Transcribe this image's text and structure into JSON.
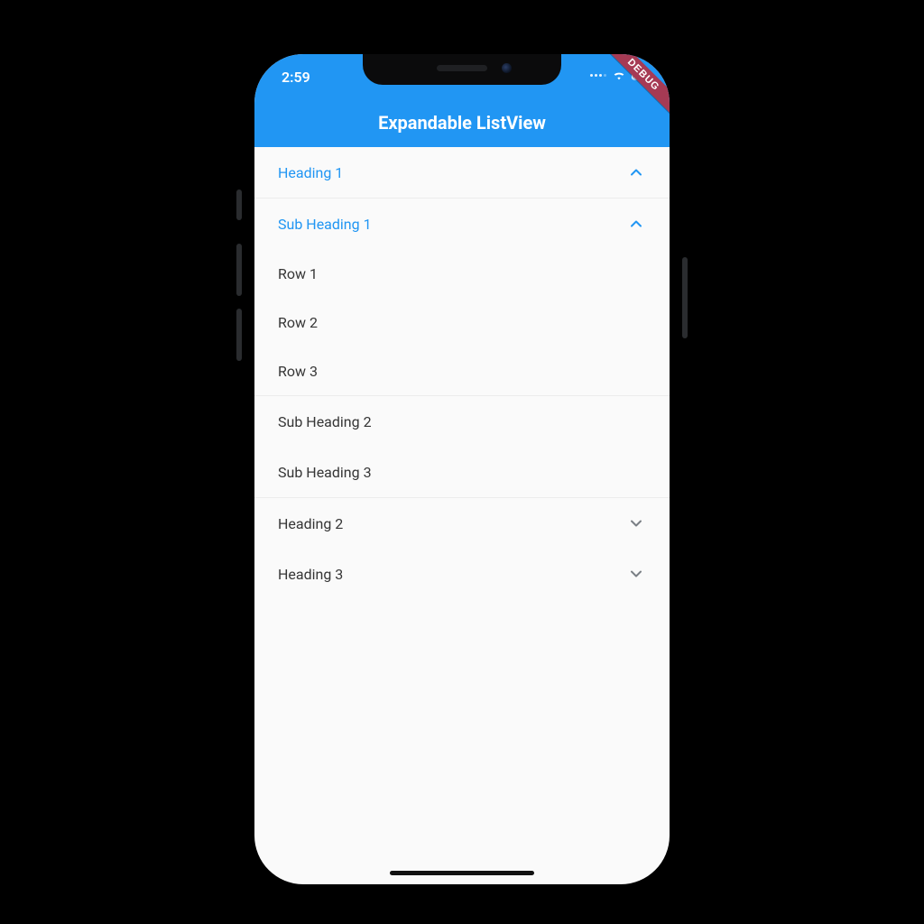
{
  "statusbar": {
    "time": "2:59"
  },
  "debug_banner": "DEBUG",
  "appbar": {
    "title": "Expandable ListView"
  },
  "colors": {
    "primary": "#2196f3"
  },
  "list": {
    "heading1": {
      "label": "Heading 1",
      "expanded": true
    },
    "sub1": {
      "label": "Sub Heading 1",
      "expanded": true
    },
    "row1": {
      "label": "Row 1"
    },
    "row2": {
      "label": "Row 2"
    },
    "row3": {
      "label": "Row 3"
    },
    "sub2": {
      "label": "Sub Heading 2"
    },
    "sub3": {
      "label": "Sub Heading 3"
    },
    "heading2": {
      "label": "Heading 2",
      "expanded": false
    },
    "heading3": {
      "label": "Heading 3",
      "expanded": false
    }
  }
}
